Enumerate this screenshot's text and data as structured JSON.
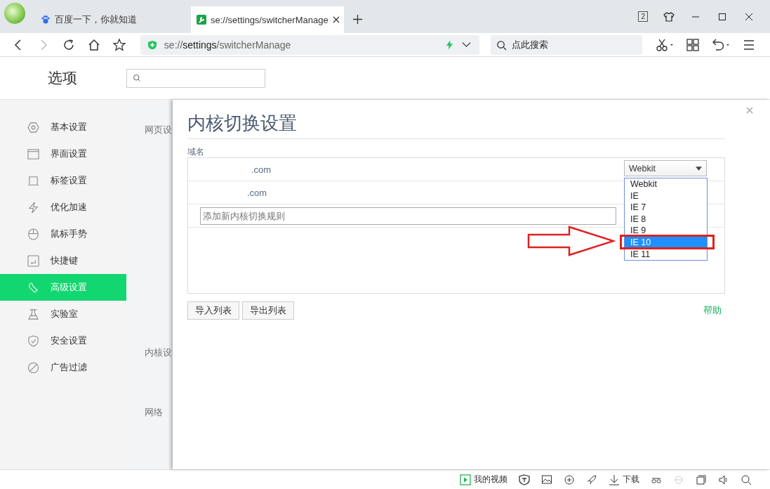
{
  "tabs": [
    {
      "label": "百度一下，你就知道",
      "selected": false
    },
    {
      "label": "se://settings/switcherManage",
      "selected": true
    }
  ],
  "tab_count": "2",
  "address": {
    "scheme": "se://",
    "host": "settings",
    "path": "/switcherManage"
  },
  "search": {
    "placeholder": "点此搜索"
  },
  "page_title": "选项",
  "sidebar": [
    {
      "label": "基本设置",
      "selected": false
    },
    {
      "label": "界面设置",
      "selected": false
    },
    {
      "label": "标签设置",
      "selected": false
    },
    {
      "label": "优化加速",
      "selected": false
    },
    {
      "label": "鼠标手势",
      "selected": false
    },
    {
      "label": "快捷键",
      "selected": false
    },
    {
      "label": "高级设置",
      "selected": true
    },
    {
      "label": "实验室",
      "selected": false
    },
    {
      "label": "安全设置",
      "selected": false
    },
    {
      "label": "广告过滤",
      "selected": false
    }
  ],
  "sections": [
    "网页设",
    "内核设",
    "网络"
  ],
  "dialog": {
    "title": "内核切换设置",
    "column": "域名",
    "rows": [
      {
        "domain": ".com",
        "engine": "Webkit"
      },
      {
        "domain": ".com"
      }
    ],
    "new_rule": {
      "placeholder": "添加新内核切换规则"
    },
    "options": [
      {
        "label": "Webkit",
        "selected": false
      },
      {
        "label": "IE",
        "selected": false
      },
      {
        "label": "IE 7",
        "selected": false
      },
      {
        "label": "IE 8",
        "selected": false
      },
      {
        "label": "IE 9",
        "selected": false
      },
      {
        "label": "IE 10",
        "selected": true
      },
      {
        "label": "IE 11",
        "selected": false
      }
    ],
    "buttons": [
      "导入列表",
      "导出列表"
    ],
    "help": "帮助"
  },
  "status_bar": {
    "video": "我的视频",
    "download": "下载"
  }
}
